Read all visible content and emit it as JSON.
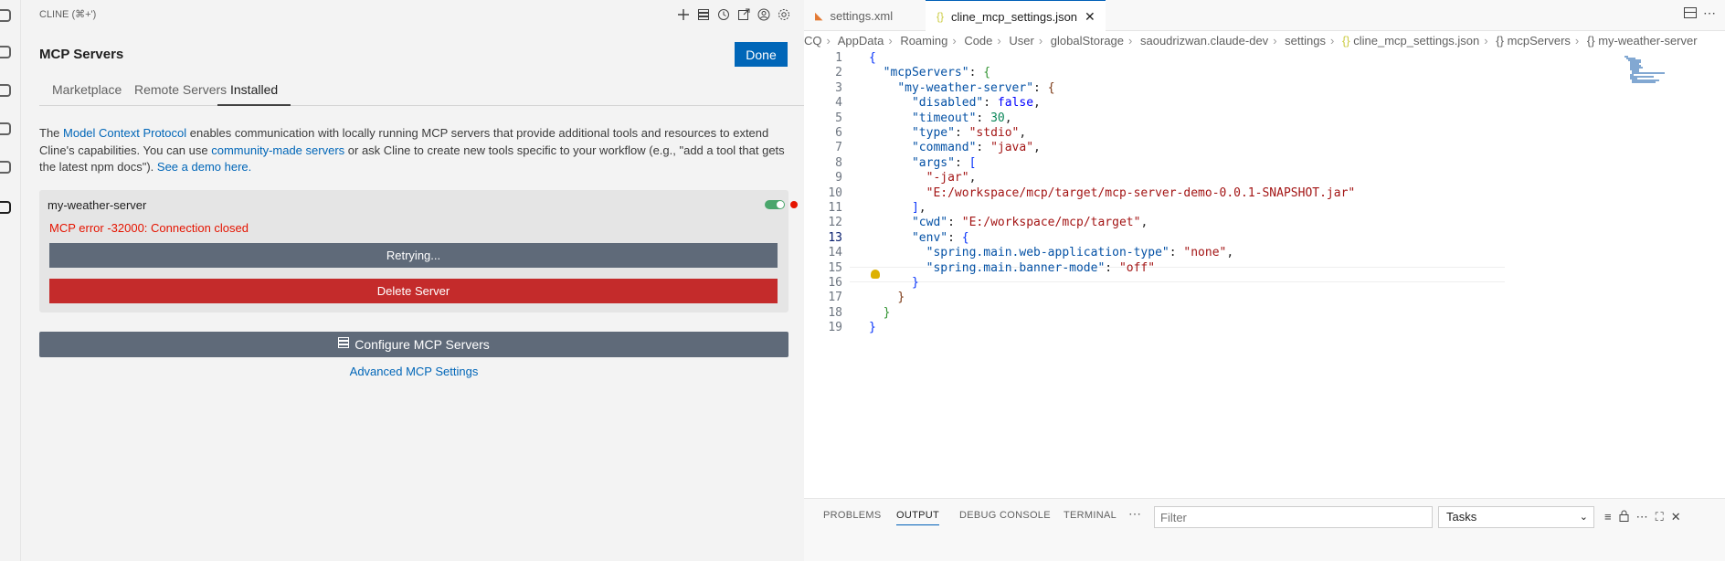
{
  "cline": {
    "title": "CLINE (⌘+')",
    "mcp_title": "MCP Servers",
    "done": "Done",
    "tabs": [
      "Marketplace",
      "Remote Servers",
      "Installed"
    ],
    "active_tab": "Installed",
    "description": {
      "p1": "The ",
      "link1": "Model Context Protocol",
      "p2": " enables communication with locally running MCP servers that provide additional tools and resources to extend Cline's capabilities. You can use ",
      "link2": "community-made servers",
      "p3": " or ask Cline to create new tools specific to your workflow (e.g., \"add a tool that gets the latest npm docs\"). ",
      "link3": "See a demo here."
    },
    "server": {
      "name": "my-weather-server",
      "error": "MCP error -32000: Connection closed",
      "retry": "Retrying...",
      "delete": "Delete Server"
    },
    "configure": "Configure MCP Servers",
    "advanced": "Advanced MCP Settings"
  },
  "editor": {
    "tabs": [
      "settings.xml",
      "cline_mcp_settings.json"
    ],
    "breadcrumb": [
      "CQ",
      "AppData",
      "Roaming",
      "Code",
      "User",
      "globalStorage",
      "saoudrizwan.claude-dev",
      "settings",
      "cline_mcp_settings.json",
      "mcpServers",
      "my-weather-server"
    ],
    "current_line": 13,
    "lines": [
      "1",
      "2",
      "3",
      "4",
      "5",
      "6",
      "7",
      "8",
      "9",
      "10",
      "11",
      "12",
      "13",
      "14",
      "15",
      "16",
      "17",
      "18",
      "19"
    ]
  },
  "code": {
    "mcpServers": "\"mcpServers\"",
    "server": "\"my-weather-server\"",
    "disabled_k": "\"disabled\"",
    "disabled_v": "false",
    "timeout_k": "\"timeout\"",
    "timeout_v": "30",
    "type_k": "\"type\"",
    "type_v": "\"stdio\"",
    "command_k": "\"command\"",
    "command_v": "\"java\"",
    "args_k": "\"args\"",
    "arg1": "\"-jar\"",
    "arg2": "\"E:/workspace/mcp/target/mcp-server-demo-0.0.1-SNAPSHOT.jar\"",
    "cwd_k": "\"cwd\"",
    "cwd_v": "\"E:/workspace/mcp/target\"",
    "env_k": "\"env\"",
    "env1_k": "\"spring.main.web-application-type\"",
    "env1_v": "\"none\"",
    "env2_k": "\"spring.main.banner-mode\"",
    "env2_v": "\"off\""
  },
  "panel": {
    "tabs": [
      "PROBLEMS",
      "OUTPUT",
      "DEBUG CONSOLE",
      "TERMINAL"
    ],
    "active": "OUTPUT",
    "filter_placeholder": "Filter",
    "select_value": "Tasks"
  },
  "colors": {
    "accent": "#0066b8",
    "error": "#e51400",
    "delete": "#c42b2b",
    "button": "#5f6a79"
  }
}
